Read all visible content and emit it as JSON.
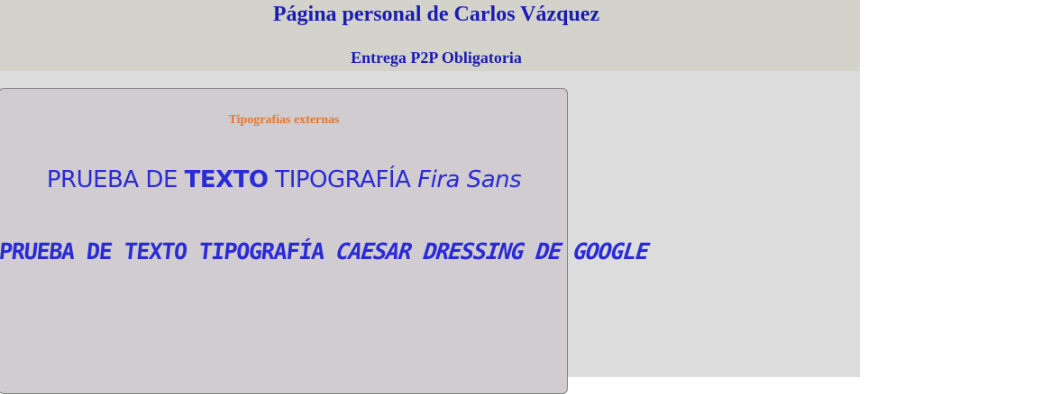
{
  "header": {
    "title": "Página personal de Carlos Vázquez",
    "subtitle": "Entrega P2P Obligatoria"
  },
  "card": {
    "heading": "Tipografías externas",
    "fira_line": {
      "part1": "PRUEBA DE ",
      "part2_bold": "TEXTO",
      "part3": " TIPOGRAFÍA ",
      "part4_italic": "Fira Sans"
    },
    "caesar_line": {
      "part1": "PRUEBA DE TEXTO TIPOGRAFÍA ",
      "part2_italic": "CAESAR DRESSING DE GOOGLE"
    }
  },
  "colors": {
    "header_bg": "#d3d3cc",
    "page_bg": "#dcdcdc",
    "card_bg": "#d0ccd0",
    "title_text": "#1c1cb4",
    "heading_accent": "#e8782a",
    "sample_text": "#2a2ad8"
  }
}
